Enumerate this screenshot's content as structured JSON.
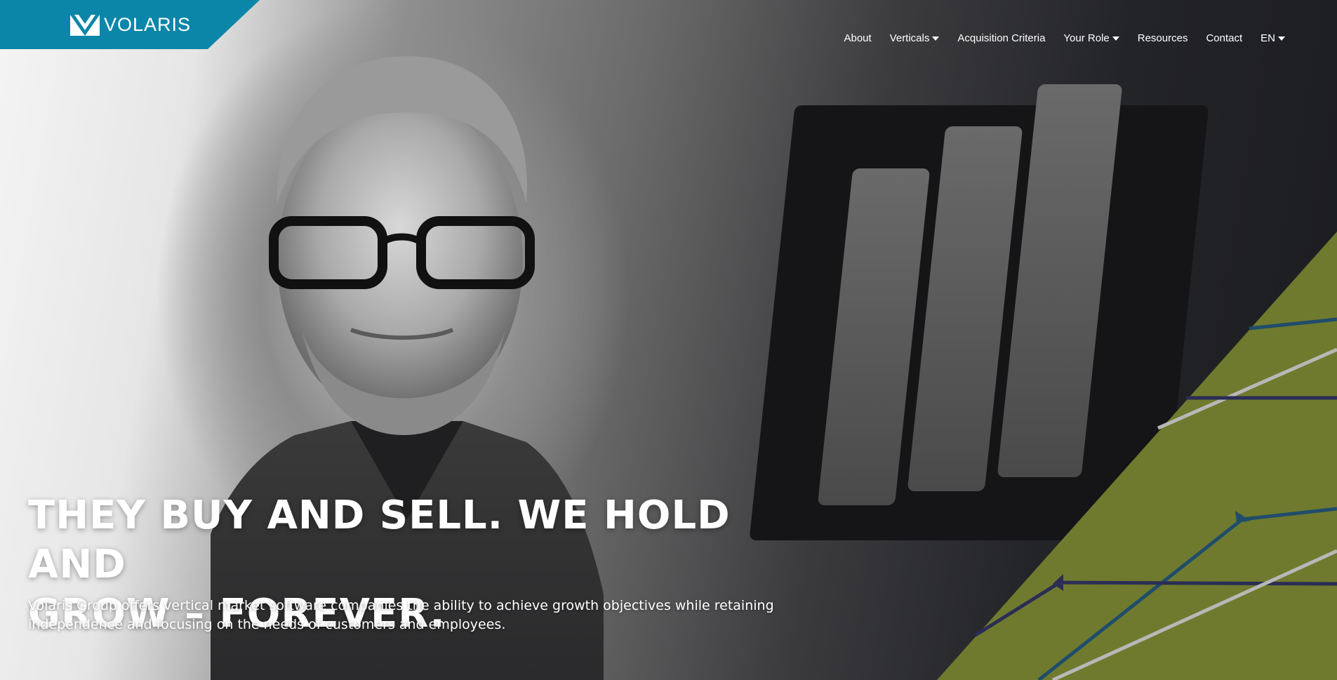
{
  "brand": {
    "logo_text": "VOLARIS",
    "color": "#0b86a8",
    "icon": "volaris-v-logo-icon"
  },
  "nav": {
    "items": [
      {
        "label": "About",
        "dropdown": false
      },
      {
        "label": "Verticals",
        "dropdown": true
      },
      {
        "label": "Acquisition Criteria",
        "dropdown": false
      },
      {
        "label": "Your Role",
        "dropdown": true
      },
      {
        "label": "Resources",
        "dropdown": false
      },
      {
        "label": "Contact",
        "dropdown": false
      },
      {
        "label": "EN",
        "dropdown": true
      }
    ]
  },
  "hero": {
    "headline_line1": "THEY BUY AND SELL. WE HOLD AND",
    "headline_line2": "GROW – FOREVER.",
    "subtext_line1": "Volaris Group offers vertical market software companies the ability to achieve growth objectives while retaining",
    "subtext_line2": "independence and focusing on the needs of customers and employees.",
    "accent_color": "#6f7a2e",
    "line_colors": [
      "#1f4d6b",
      "#2b2d55",
      "#b8b8b8"
    ]
  }
}
